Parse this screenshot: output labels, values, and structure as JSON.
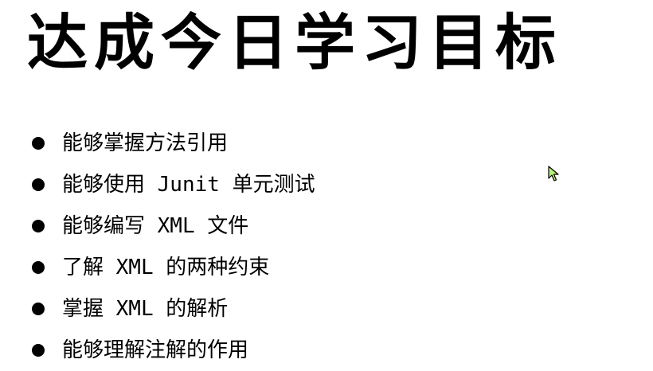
{
  "slide": {
    "title": "达成今日学习目标",
    "goals": [
      "能够掌握方法引用",
      "能够使用 Junit 单元测试",
      "能够编写 XML 文件",
      "了解 XML 的两种约束",
      "掌握 XML 的解析",
      "能够理解注解的作用"
    ]
  },
  "colors": {
    "background": "#ffffff",
    "text": "#000000",
    "cursor_fill": "#b9f27a",
    "cursor_stroke": "#000000"
  },
  "icons": {
    "cursor": "mouse-pointer-icon",
    "bullet": "filled-circle-bullet-icon"
  }
}
